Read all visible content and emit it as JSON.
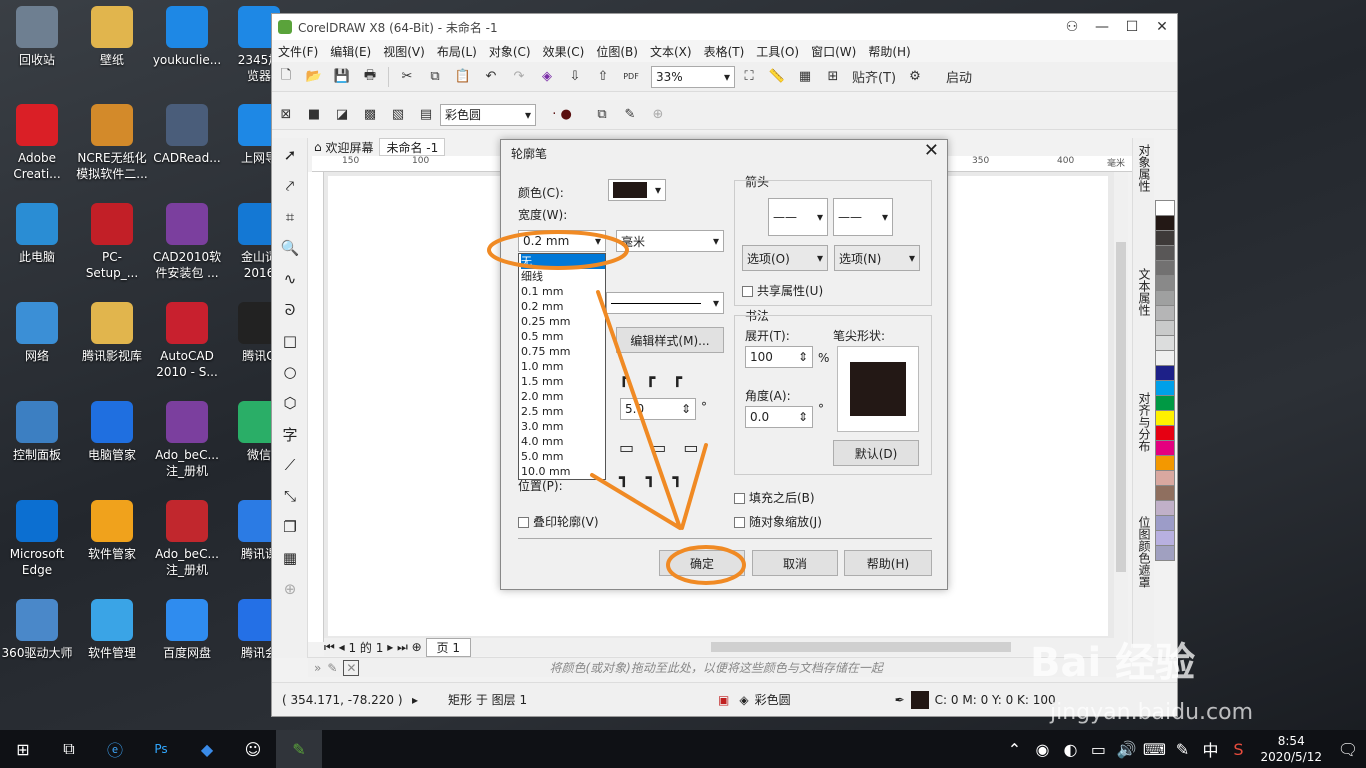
{
  "desktop": {
    "icons": [
      {
        "label": "回收站",
        "icon": "recycle-bin-icon",
        "color": "#6e7f91"
      },
      {
        "label": "Adobe\nCreati...",
        "icon": "adobe-cc-icon",
        "color": "#da1f26"
      },
      {
        "label": "此电脑",
        "icon": "computer-icon",
        "color": "#2a8dd4"
      },
      {
        "label": "网络",
        "icon": "network-icon",
        "color": "#3b8fd6"
      },
      {
        "label": "控制面板",
        "icon": "control-panel-icon",
        "color": "#3c7fc2"
      },
      {
        "label": "Microsoft\nEdge",
        "icon": "edge-icon",
        "color": "#0c6fd1"
      },
      {
        "label": "360驱动大师",
        "icon": "driver-master-icon",
        "color": "#4a88c9"
      },
      {
        "label": "壁纸",
        "icon": "folder-icon",
        "color": "#e1b54d"
      },
      {
        "label": "NCRE无纸化\n模拟软件二...",
        "icon": "tiger-icon",
        "color": "#d38a2a"
      },
      {
        "label": "PC-Setup_...",
        "icon": "hb-installer-icon",
        "color": "#c21f27"
      },
      {
        "label": "腾讯影视库",
        "icon": "folder-icon",
        "color": "#e1b54d"
      },
      {
        "label": "电脑管家",
        "icon": "pc-manager-icon",
        "color": "#1f6fe0"
      },
      {
        "label": "软件管家",
        "icon": "software-manager-icon",
        "color": "#f0a21c"
      },
      {
        "label": "软件管理",
        "icon": "software-manage-icon",
        "color": "#3aa4e6"
      },
      {
        "label": "youkuclie...",
        "icon": "youku-icon",
        "color": "#1e88e5"
      },
      {
        "label": "CADRead...",
        "icon": "cadreader-icon",
        "color": "#4a5d7a"
      },
      {
        "label": "CAD2010软\n件安装包 ...",
        "icon": "winrar-icon",
        "color": "#7b3f9e"
      },
      {
        "label": "AutoCAD\n2010 - S...",
        "icon": "autocad-icon",
        "color": "#c8202e"
      },
      {
        "label": "Ado_beC...\n注_册机",
        "icon": "winrar-icon",
        "color": "#7b3f9e"
      },
      {
        "label": "Ado_beC...\n注_册机",
        "icon": "shield-icon",
        "color": "#c1272d"
      },
      {
        "label": "百度网盘",
        "icon": "baidu-netdisk-icon",
        "color": "#2f8cef"
      },
      {
        "label": "2345加\n览器",
        "icon": "browser-icon",
        "color": "#1e88e5"
      },
      {
        "label": "上网导",
        "icon": "ie-icon",
        "color": "#1e88e5"
      },
      {
        "label": "金山词\n2016",
        "icon": "kingsoft-icon",
        "color": "#1478d4"
      },
      {
        "label": "腾讯Q",
        "icon": "qq-icon",
        "color": "#222222"
      },
      {
        "label": "微信",
        "icon": "wechat-icon",
        "color": "#2aae67"
      },
      {
        "label": "腾讯课",
        "icon": "tencent-class-icon",
        "color": "#2b7be4"
      },
      {
        "label": "腾讯会",
        "icon": "tencent-meeting-icon",
        "color": "#2470e6"
      }
    ]
  },
  "window": {
    "title": "CorelDRAW X8 (64-Bit) - 未命名 -1",
    "menu": [
      "文件(F)",
      "编辑(E)",
      "视图(V)",
      "布局(L)",
      "对象(C)",
      "效果(C)",
      "位图(B)",
      "文本(X)",
      "表格(T)",
      "工具(O)",
      "窗口(W)",
      "帮助(H)"
    ],
    "zoom": "33%",
    "snap_label": "贴齐(T)",
    "launch_label": "启动",
    "pdf_label": "PDF",
    "fill_combo": "彩色圆",
    "tabs": {
      "welcome": "欢迎屏幕",
      "doc": "未命名 -1"
    },
    "ruler_marks": [
      "150",
      "100",
      "350",
      "400",
      "毫米"
    ],
    "docker_tabs": [
      "对象属性",
      "文本属性",
      "对齐与分布",
      "位图颜色遮罩"
    ],
    "palette": [
      "#ffffff",
      "#231815",
      "#3e3a39",
      "#595757",
      "#727171",
      "#898989",
      "#9fa0a0",
      "#b5b5b6",
      "#c9caca",
      "#dcdddd",
      "#efefef",
      "#1d2088",
      "#00a0e9",
      "#009944",
      "#fff100",
      "#e60012",
      "#e4007f",
      "#f39800",
      "#d9a8a0",
      "#8f6f5f",
      "#c0b0c8",
      "#9c9cc8",
      "#b8b0e0",
      "#a0a0c0"
    ],
    "page_nav": {
      "label": "1 的 1",
      "tab": "页 1"
    },
    "colorbar_hint": "将颜色(或对象)拖动至此处，以便将这些颜色与文档存储在一起",
    "status": {
      "coords": "( 354.171, -78.220 )",
      "object": "矩形 于 图层 1",
      "fill_name": "彩色圆",
      "outline": "C: 0 M: 0 Y: 0 K: 100"
    }
  },
  "dialog": {
    "title": "轮廓笔",
    "color_label": "颜色(C):",
    "outline_color": "#231815",
    "width_label": "宽度(W):",
    "width_value": "0.2 mm",
    "unit_value": "毫米",
    "width_options": [
      "无",
      "细线",
      "0.1 mm",
      "0.2 mm",
      "0.25 mm",
      "0.5 mm",
      "0.75 mm",
      "1.0 mm",
      "1.5 mm",
      "2.0 mm",
      "2.5 mm",
      "3.0 mm",
      "4.0 mm",
      "5.0 mm",
      "10.0 mm"
    ],
    "edit_style_label": "编辑样式(M)...",
    "angle_field": "5.0",
    "position_label": "位置(P):",
    "overprint_label": "叠印轮廓(V)",
    "arrows_label": "箭头",
    "options_left": "选项(O)",
    "options_right": "选项(N)",
    "share_attr_label": "共享属性(U)",
    "calligraphy_label": "书法",
    "stretch_label": "展开(T):",
    "stretch_value": "100",
    "stretch_unit": "%",
    "nib_label": "笔尖形状:",
    "angle_label": "角度(A):",
    "angle_value": "0.0",
    "angle_unit": "°",
    "default_label": "默认(D)",
    "behind_fill_label": "填充之后(B)",
    "scale_label": "随对象缩放(J)",
    "ok_label": "确定",
    "cancel_label": "取消",
    "help_label": "帮助(H)"
  },
  "annotation_color": "#f08a24",
  "taskbar": {
    "time": "8:54",
    "date": "2020/5/12",
    "ime": "中"
  },
  "watermark": {
    "brand": "Bai 经验",
    "url": "jingyan.baidu.com"
  }
}
